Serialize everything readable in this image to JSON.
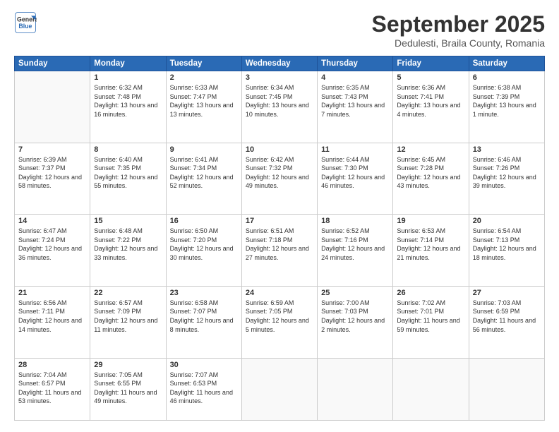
{
  "header": {
    "logo_line1": "General",
    "logo_line2": "Blue",
    "month": "September 2025",
    "location": "Dedulesti, Braila County, Romania"
  },
  "weekdays": [
    "Sunday",
    "Monday",
    "Tuesday",
    "Wednesday",
    "Thursday",
    "Friday",
    "Saturday"
  ],
  "weeks": [
    [
      {
        "day": "",
        "sunrise": "",
        "sunset": "",
        "daylight": ""
      },
      {
        "day": "1",
        "sunrise": "Sunrise: 6:32 AM",
        "sunset": "Sunset: 7:48 PM",
        "daylight": "Daylight: 13 hours and 16 minutes."
      },
      {
        "day": "2",
        "sunrise": "Sunrise: 6:33 AM",
        "sunset": "Sunset: 7:47 PM",
        "daylight": "Daylight: 13 hours and 13 minutes."
      },
      {
        "day": "3",
        "sunrise": "Sunrise: 6:34 AM",
        "sunset": "Sunset: 7:45 PM",
        "daylight": "Daylight: 13 hours and 10 minutes."
      },
      {
        "day": "4",
        "sunrise": "Sunrise: 6:35 AM",
        "sunset": "Sunset: 7:43 PM",
        "daylight": "Daylight: 13 hours and 7 minutes."
      },
      {
        "day": "5",
        "sunrise": "Sunrise: 6:36 AM",
        "sunset": "Sunset: 7:41 PM",
        "daylight": "Daylight: 13 hours and 4 minutes."
      },
      {
        "day": "6",
        "sunrise": "Sunrise: 6:38 AM",
        "sunset": "Sunset: 7:39 PM",
        "daylight": "Daylight: 13 hours and 1 minute."
      }
    ],
    [
      {
        "day": "7",
        "sunrise": "Sunrise: 6:39 AM",
        "sunset": "Sunset: 7:37 PM",
        "daylight": "Daylight: 12 hours and 58 minutes."
      },
      {
        "day": "8",
        "sunrise": "Sunrise: 6:40 AM",
        "sunset": "Sunset: 7:35 PM",
        "daylight": "Daylight: 12 hours and 55 minutes."
      },
      {
        "day": "9",
        "sunrise": "Sunrise: 6:41 AM",
        "sunset": "Sunset: 7:34 PM",
        "daylight": "Daylight: 12 hours and 52 minutes."
      },
      {
        "day": "10",
        "sunrise": "Sunrise: 6:42 AM",
        "sunset": "Sunset: 7:32 PM",
        "daylight": "Daylight: 12 hours and 49 minutes."
      },
      {
        "day": "11",
        "sunrise": "Sunrise: 6:44 AM",
        "sunset": "Sunset: 7:30 PM",
        "daylight": "Daylight: 12 hours and 46 minutes."
      },
      {
        "day": "12",
        "sunrise": "Sunrise: 6:45 AM",
        "sunset": "Sunset: 7:28 PM",
        "daylight": "Daylight: 12 hours and 43 minutes."
      },
      {
        "day": "13",
        "sunrise": "Sunrise: 6:46 AM",
        "sunset": "Sunset: 7:26 PM",
        "daylight": "Daylight: 12 hours and 39 minutes."
      }
    ],
    [
      {
        "day": "14",
        "sunrise": "Sunrise: 6:47 AM",
        "sunset": "Sunset: 7:24 PM",
        "daylight": "Daylight: 12 hours and 36 minutes."
      },
      {
        "day": "15",
        "sunrise": "Sunrise: 6:48 AM",
        "sunset": "Sunset: 7:22 PM",
        "daylight": "Daylight: 12 hours and 33 minutes."
      },
      {
        "day": "16",
        "sunrise": "Sunrise: 6:50 AM",
        "sunset": "Sunset: 7:20 PM",
        "daylight": "Daylight: 12 hours and 30 minutes."
      },
      {
        "day": "17",
        "sunrise": "Sunrise: 6:51 AM",
        "sunset": "Sunset: 7:18 PM",
        "daylight": "Daylight: 12 hours and 27 minutes."
      },
      {
        "day": "18",
        "sunrise": "Sunrise: 6:52 AM",
        "sunset": "Sunset: 7:16 PM",
        "daylight": "Daylight: 12 hours and 24 minutes."
      },
      {
        "day": "19",
        "sunrise": "Sunrise: 6:53 AM",
        "sunset": "Sunset: 7:14 PM",
        "daylight": "Daylight: 12 hours and 21 minutes."
      },
      {
        "day": "20",
        "sunrise": "Sunrise: 6:54 AM",
        "sunset": "Sunset: 7:13 PM",
        "daylight": "Daylight: 12 hours and 18 minutes."
      }
    ],
    [
      {
        "day": "21",
        "sunrise": "Sunrise: 6:56 AM",
        "sunset": "Sunset: 7:11 PM",
        "daylight": "Daylight: 12 hours and 14 minutes."
      },
      {
        "day": "22",
        "sunrise": "Sunrise: 6:57 AM",
        "sunset": "Sunset: 7:09 PM",
        "daylight": "Daylight: 12 hours and 11 minutes."
      },
      {
        "day": "23",
        "sunrise": "Sunrise: 6:58 AM",
        "sunset": "Sunset: 7:07 PM",
        "daylight": "Daylight: 12 hours and 8 minutes."
      },
      {
        "day": "24",
        "sunrise": "Sunrise: 6:59 AM",
        "sunset": "Sunset: 7:05 PM",
        "daylight": "Daylight: 12 hours and 5 minutes."
      },
      {
        "day": "25",
        "sunrise": "Sunrise: 7:00 AM",
        "sunset": "Sunset: 7:03 PM",
        "daylight": "Daylight: 12 hours and 2 minutes."
      },
      {
        "day": "26",
        "sunrise": "Sunrise: 7:02 AM",
        "sunset": "Sunset: 7:01 PM",
        "daylight": "Daylight: 11 hours and 59 minutes."
      },
      {
        "day": "27",
        "sunrise": "Sunrise: 7:03 AM",
        "sunset": "Sunset: 6:59 PM",
        "daylight": "Daylight: 11 hours and 56 minutes."
      }
    ],
    [
      {
        "day": "28",
        "sunrise": "Sunrise: 7:04 AM",
        "sunset": "Sunset: 6:57 PM",
        "daylight": "Daylight: 11 hours and 53 minutes."
      },
      {
        "day": "29",
        "sunrise": "Sunrise: 7:05 AM",
        "sunset": "Sunset: 6:55 PM",
        "daylight": "Daylight: 11 hours and 49 minutes."
      },
      {
        "day": "30",
        "sunrise": "Sunrise: 7:07 AM",
        "sunset": "Sunset: 6:53 PM",
        "daylight": "Daylight: 11 hours and 46 minutes."
      },
      {
        "day": "",
        "sunrise": "",
        "sunset": "",
        "daylight": ""
      },
      {
        "day": "",
        "sunrise": "",
        "sunset": "",
        "daylight": ""
      },
      {
        "day": "",
        "sunrise": "",
        "sunset": "",
        "daylight": ""
      },
      {
        "day": "",
        "sunrise": "",
        "sunset": "",
        "daylight": ""
      }
    ]
  ]
}
